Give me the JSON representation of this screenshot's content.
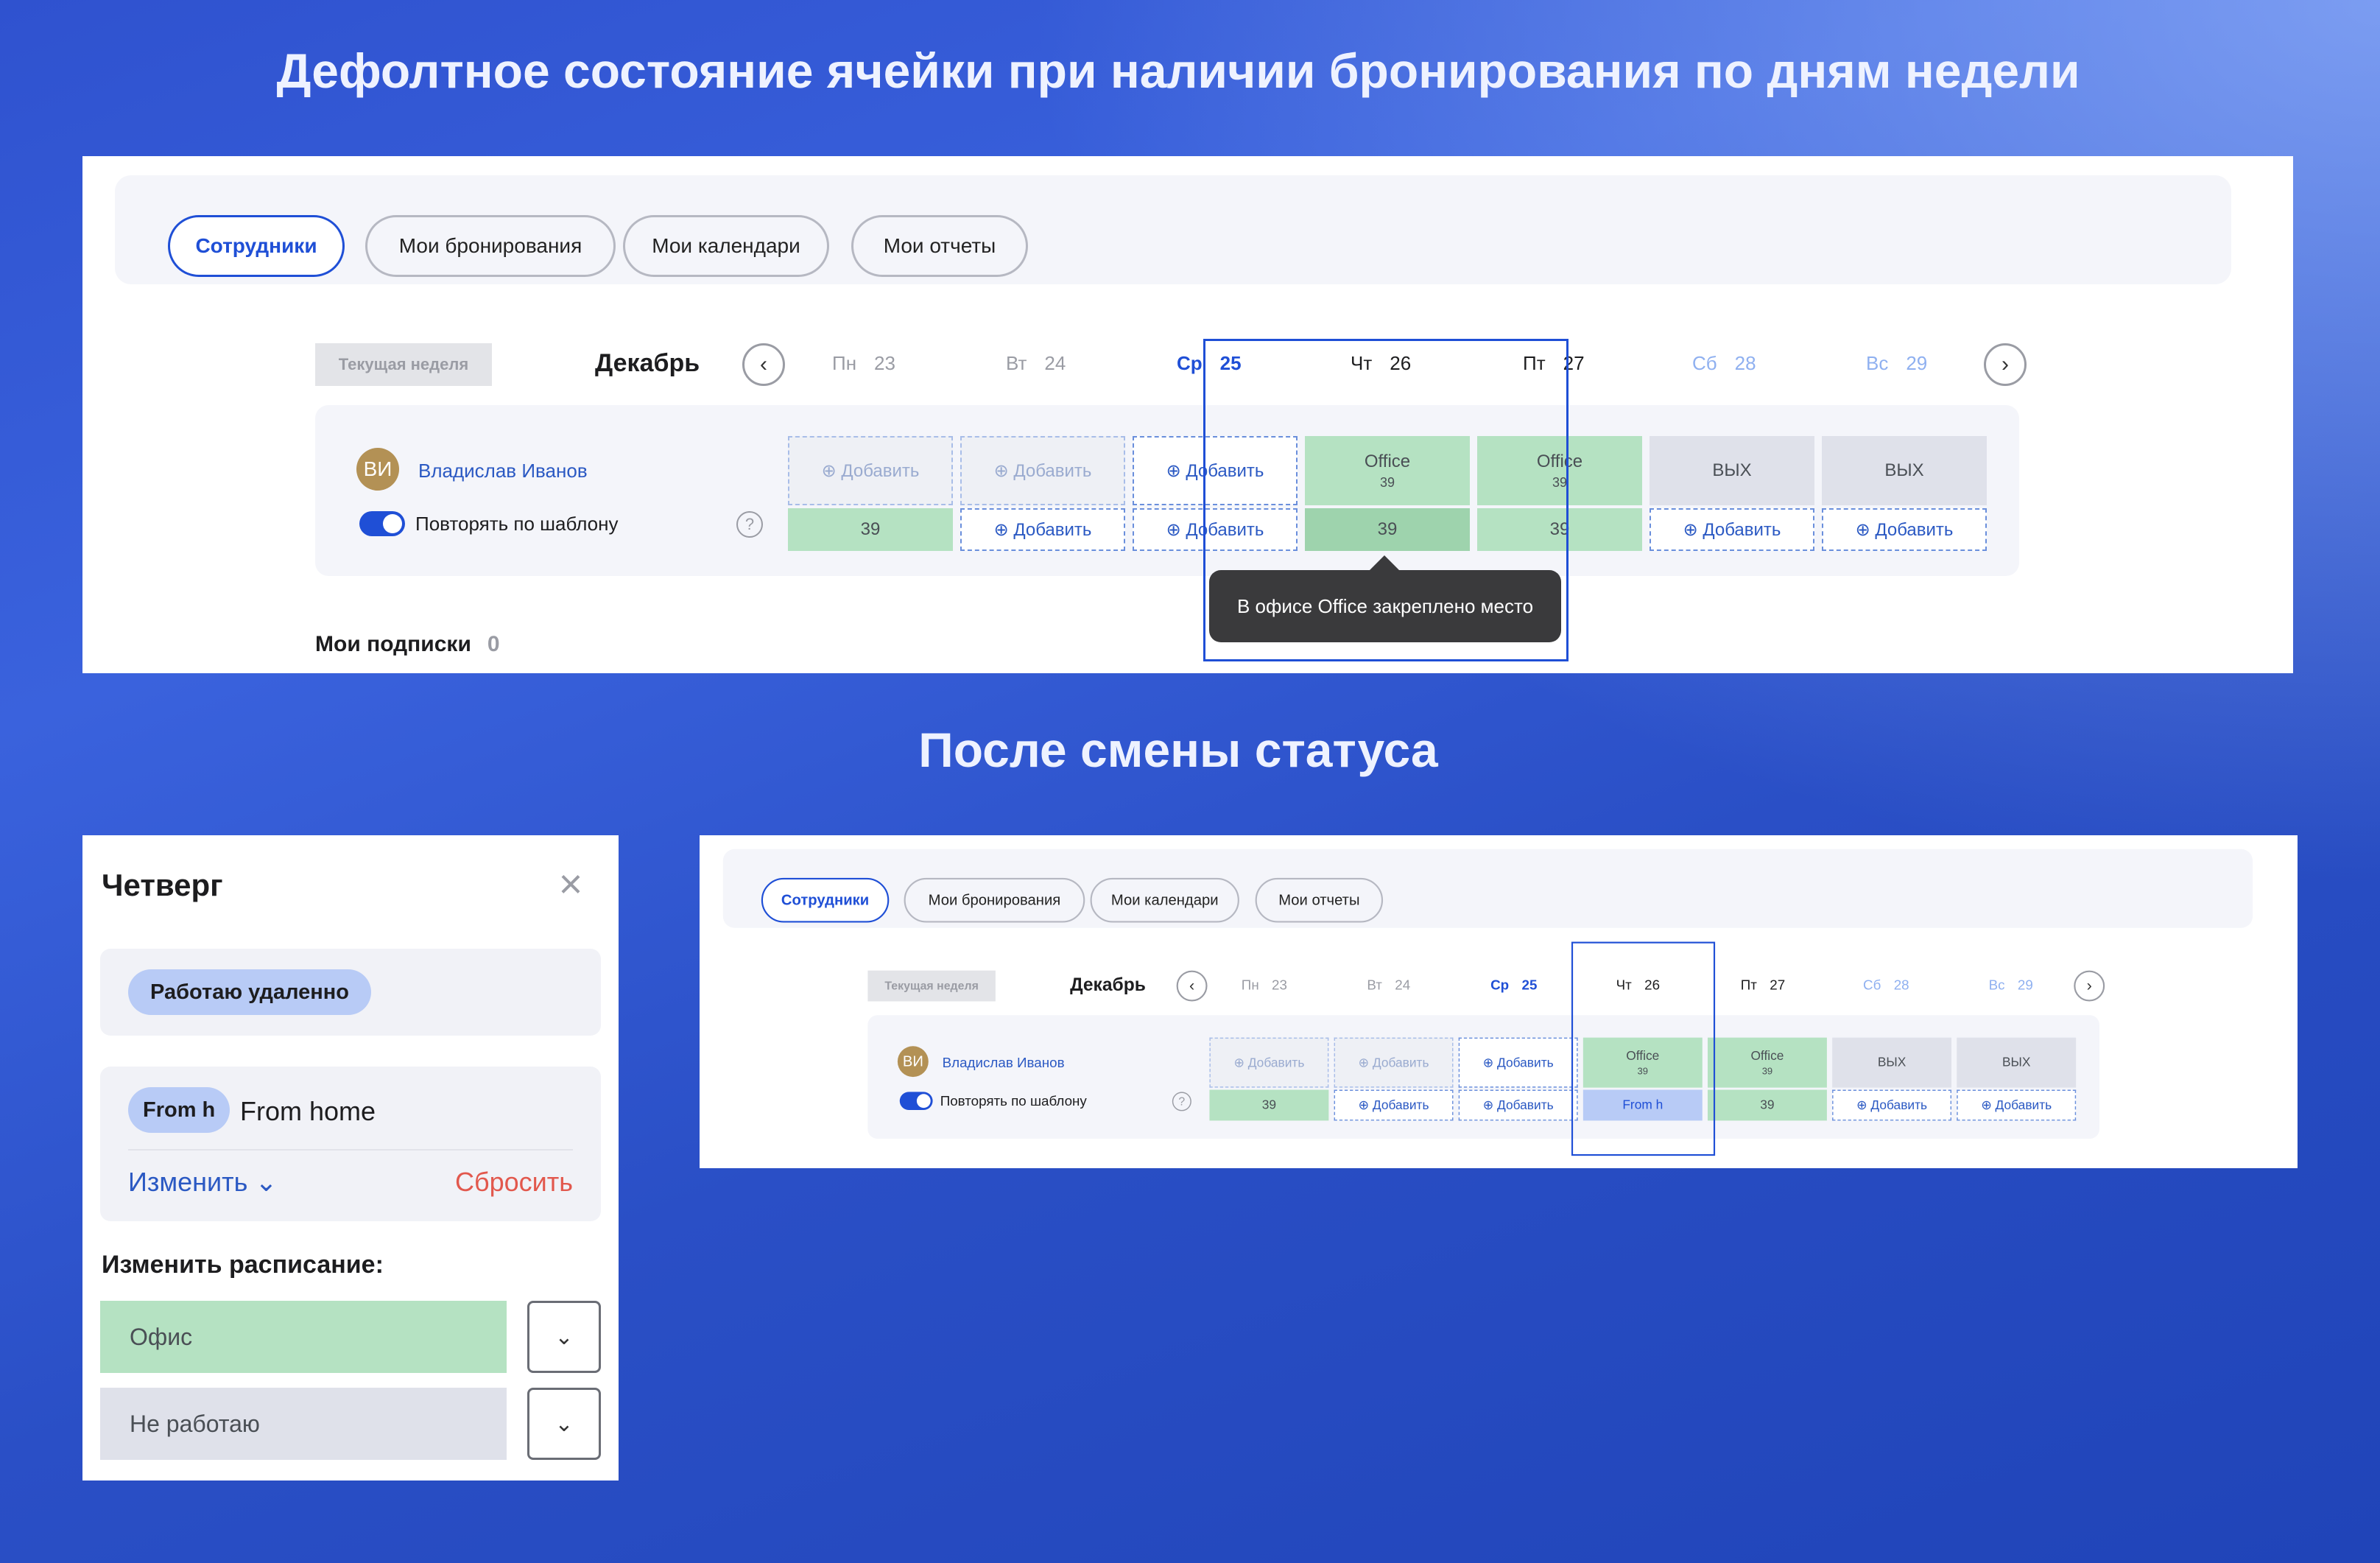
{
  "headings": {
    "top": "Дефолтное состояние ячейки при наличии бронирования по дням недели",
    "middle": "После смены статуса"
  },
  "tabs": [
    {
      "label": "Сотрудники",
      "active": true
    },
    {
      "label": "Мои бронирования",
      "active": false
    },
    {
      "label": "Мои календари",
      "active": false
    },
    {
      "label": "Мои отчеты",
      "active": false
    }
  ],
  "week_button": "Текущая неделя",
  "month": "Декабрь",
  "nav": {
    "prev_icon": "chevron-left-icon",
    "next_icon": "chevron-right-icon",
    "prev": "‹",
    "next": "›"
  },
  "days": [
    {
      "name": "Пн",
      "num": "23"
    },
    {
      "name": "Вт",
      "num": "24"
    },
    {
      "name": "Ср",
      "num": "25"
    },
    {
      "name": "Чт",
      "num": "26"
    },
    {
      "name": "Пт",
      "num": "27"
    },
    {
      "name": "Сб",
      "num": "28"
    },
    {
      "name": "Вс",
      "num": "29"
    }
  ],
  "user": {
    "initials": "ВИ",
    "name": "Владислав Иванов",
    "repeat_label": "Повторять по шаблону",
    "help": "?"
  },
  "add_label": "⊕ Добавить",
  "cells_before": {
    "top": [
      {
        "type": "add-disabled",
        "text": "⊕ Добавить"
      },
      {
        "type": "add-disabled",
        "text": "⊕ Добавить"
      },
      {
        "type": "add",
        "text": "⊕ Добавить"
      },
      {
        "type": "office",
        "text": "Office",
        "sub": "39"
      },
      {
        "type": "office",
        "text": "Office",
        "sub": "39"
      },
      {
        "type": "off",
        "text": "ВЫХ"
      },
      {
        "type": "off",
        "text": "ВЫХ"
      }
    ],
    "bottom": [
      {
        "type": "green",
        "text": "39"
      },
      {
        "type": "add",
        "text": "⊕ Добавить"
      },
      {
        "type": "add",
        "text": "⊕ Добавить"
      },
      {
        "type": "green-dark",
        "text": "39"
      },
      {
        "type": "green",
        "text": "39"
      },
      {
        "type": "add",
        "text": "⊕ Добавить"
      },
      {
        "type": "add",
        "text": "⊕ Добавить"
      }
    ]
  },
  "cells_after": {
    "top": [
      {
        "type": "add-disabled",
        "text": "⊕ Добавить"
      },
      {
        "type": "add-disabled",
        "text": "⊕ Добавить"
      },
      {
        "type": "add",
        "text": "⊕ Добавить"
      },
      {
        "type": "office",
        "text": "Office",
        "sub": "39"
      },
      {
        "type": "office",
        "text": "Office",
        "sub": "39"
      },
      {
        "type": "off",
        "text": "ВЫХ"
      },
      {
        "type": "off",
        "text": "ВЫХ"
      }
    ],
    "bottom": [
      {
        "type": "green",
        "text": "39"
      },
      {
        "type": "add",
        "text": "⊕ Добавить"
      },
      {
        "type": "add",
        "text": "⊕ Добавить"
      },
      {
        "type": "blue",
        "text": "From h"
      },
      {
        "type": "green",
        "text": "39"
      },
      {
        "type": "add",
        "text": "⊕ Добавить"
      },
      {
        "type": "add",
        "text": "⊕ Добавить"
      }
    ]
  },
  "tooltip": "В офисе Office закреплено место",
  "subscriptions": {
    "label": "Мои подписки",
    "count": "0"
  },
  "drawer": {
    "title": "Четверг",
    "close": "×",
    "status_chip": "Работаю удаленно",
    "location_chip": "From h",
    "location_value": "From home",
    "change": "Изменить ⌄",
    "reset": "Сбросить",
    "schedule_label": "Изменить расписание:",
    "options": [
      {
        "label": "Офис",
        "color": "#b5e2c2"
      },
      {
        "label": "Не работаю",
        "color": "#dfe1ea"
      }
    ],
    "dropdown_icon": "⌄"
  },
  "colors": {
    "accent": "#1f4fd6",
    "office": "#b5e2c2",
    "remote": "#b8cbf6",
    "off": "#dfe1ea",
    "reset": "#e2584d"
  }
}
